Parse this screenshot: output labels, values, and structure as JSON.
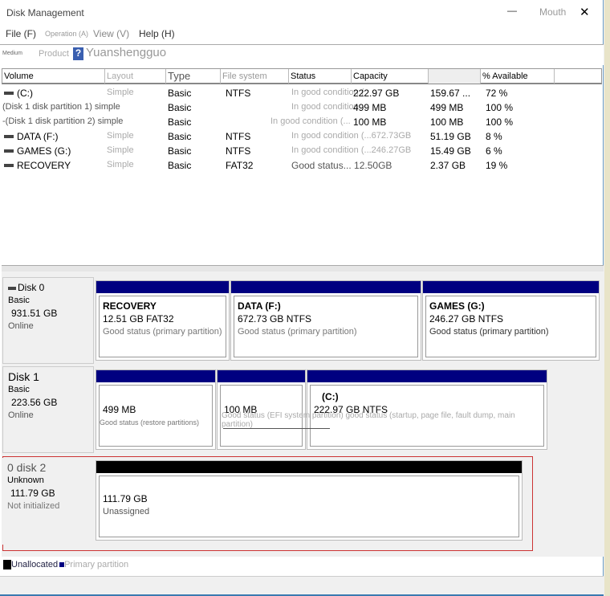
{
  "window": {
    "title": "Disk Management",
    "minimize": "—",
    "mouth": "Mouth",
    "close": "✕"
  },
  "menu": [
    "File (F)",
    "Operation (A)",
    "View (V)",
    "Help (H)"
  ],
  "toolbar": {
    "medium": "Medium",
    "product": "Product",
    "help_icon": "?",
    "name": "Yuanshengguo"
  },
  "table": {
    "columns": [
      "Volume",
      "Layout",
      "Type",
      "File system",
      "Status",
      "Capacity",
      "",
      "% Available"
    ],
    "rows": [
      {
        "volume": "(C:)",
        "layout": "Simple",
        "type": "Basic",
        "fs": "NTFS",
        "status": "In good condition (",
        "capacity": "222.97 GB",
        "free": "159.67 ...",
        "pct": "72 %"
      },
      {
        "volume": "(Disk 1 disk partition 1) simple",
        "layout": "",
        "type": "Basic",
        "fs": "",
        "status": "In good condition",
        "capacity": "499 MB",
        "free": "499 MB",
        "pct": "100 %"
      },
      {
        "volume": "-(Disk 1 disk partition 2) simple",
        "layout": "",
        "type": "Basic",
        "fs": "",
        "status": "In good condition (...",
        "capacity": "100 MB",
        "free": "100 MB",
        "pct": "100 %"
      },
      {
        "volume": "DATA (F:)",
        "layout": "Simple",
        "type": "Basic",
        "fs": "NTFS",
        "status": "In good condition (...672.73GB",
        "capacity": "",
        "free": "51.19 GB",
        "pct": "8 %"
      },
      {
        "volume": "GAMES (G:)",
        "layout": "Simple",
        "type": "Basic",
        "fs": "NTFS",
        "status": "In good condition (...246.27GB",
        "capacity": "",
        "free": "15.49 GB",
        "pct": "6 %"
      },
      {
        "volume": "RECOVERY",
        "layout": "Simple",
        "type": "Basic",
        "fs": "FAT32",
        "status": "Good status... 12.50GB",
        "capacity": "",
        "free": "2.37 GB",
        "pct": "19 %"
      }
    ]
  },
  "disks": [
    {
      "name": "Disk 0",
      "type": "Basic",
      "size": "931.51 GB",
      "state": "Online",
      "partitions": [
        {
          "name": "RECOVERY",
          "size": "12.51 GB FAT32",
          "status": "Good status (primary partition)"
        },
        {
          "name": "DATA  (F:)",
          "size": "672.73 GB NTFS",
          "status": "Good status (primary partition)"
        },
        {
          "name": "GAMES  (G:)",
          "size": "246.27 GB NTFS",
          "status": "Good status (primary partition)"
        }
      ]
    },
    {
      "name": "Disk 1",
      "type": "Basic",
      "size": "223.56 GB",
      "state": "Online",
      "partitions": [
        {
          "name": "",
          "size": "499 MB",
          "status": "Good status (restore partitions)"
        },
        {
          "name": "",
          "size": "100 MB",
          "status": "Good status (EFI system partition) good status (startup, page file, fault dump, main partition)"
        },
        {
          "name": "(C:)",
          "size": "222.97 GB NTFS",
          "status": ""
        }
      ]
    },
    {
      "name": "0 disk 2",
      "type": "Unknown",
      "size": "111.79 GB",
      "state": "Not initialized",
      "partitions": [
        {
          "name": "",
          "size": "111.79 GB",
          "status": "Unassigned"
        }
      ]
    }
  ],
  "legend": {
    "unallocated": "Unallocated",
    "primary": "Primary partition"
  },
  "colors": {
    "primary": "#000080",
    "unallocated": "#000000",
    "selected_border": "#cc3333"
  }
}
